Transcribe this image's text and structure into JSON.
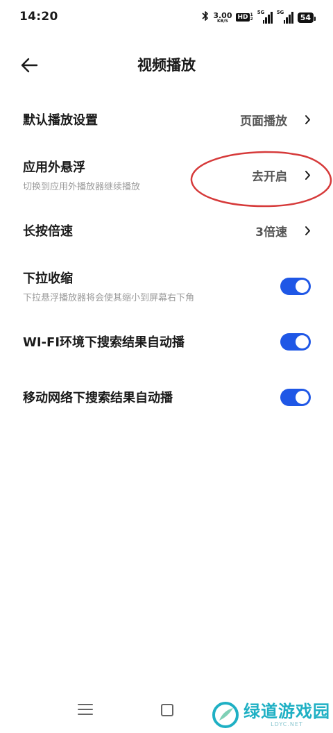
{
  "status_bar": {
    "time": "14:20",
    "net_speed": "3.00",
    "net_unit": "KB/S",
    "hd_label": "HD",
    "sim_numbers": [
      "1",
      "2"
    ],
    "signal_1_label": "5G",
    "signal_2_label": "5G",
    "battery": "54",
    "icons": [
      "bluetooth-icon",
      "hd-icon",
      "signal-icon",
      "signal-icon",
      "battery-icon"
    ]
  },
  "header": {
    "title": "视频播放",
    "back_icon": "arrow-left-icon"
  },
  "settings": [
    {
      "id": "default-playback",
      "label": "默认播放设置",
      "value": "页面播放",
      "control": "chevron"
    },
    {
      "id": "floating",
      "label": "应用外悬浮",
      "subtitle": "切换到应用外播放器继续播放",
      "value": "去开启",
      "control": "chevron"
    },
    {
      "id": "long-press-speed",
      "label": "长按倍速",
      "value": "3倍速",
      "control": "chevron"
    },
    {
      "id": "pull-down-shrink",
      "label": "下拉收缩",
      "subtitle": "下拉悬浮播放器将会使其缩小到屏幕右下角",
      "control": "toggle",
      "enabled": true
    },
    {
      "id": "wifi-autoplay",
      "label": "WI-FI环境下搜索结果自动播",
      "control": "toggle",
      "enabled": true
    },
    {
      "id": "mobile-autoplay",
      "label": "移动网络下搜索结果自动播",
      "control": "toggle",
      "enabled": true
    }
  ],
  "colors": {
    "toggle_on": "#1f57e6",
    "annotation_red": "#d63a3a",
    "watermark": "#1fb0c4"
  },
  "watermark": {
    "text": "绿道游戏园",
    "sub": "LDYC.NET"
  }
}
